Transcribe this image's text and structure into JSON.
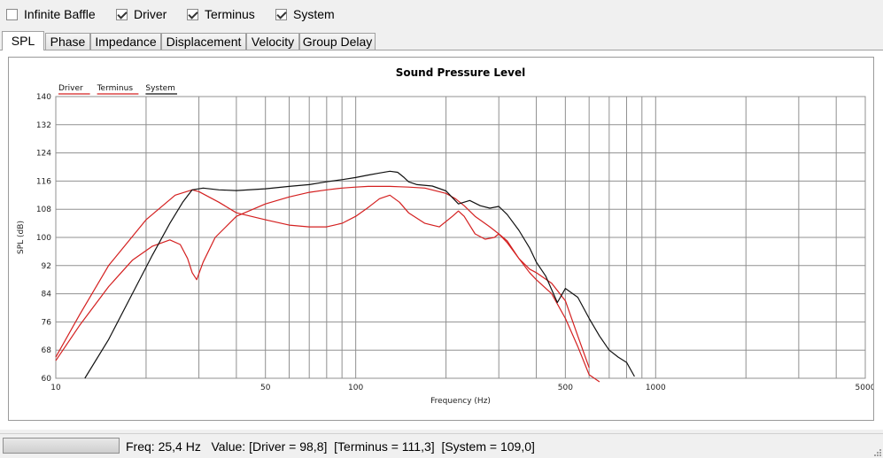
{
  "checkboxes": [
    {
      "label": "Infinite Baffle",
      "checked": false
    },
    {
      "label": "Driver",
      "checked": true
    },
    {
      "label": "Terminus",
      "checked": true
    },
    {
      "label": "System",
      "checked": true
    }
  ],
  "tabs": [
    {
      "label": "SPL",
      "active": true
    },
    {
      "label": "Phase",
      "active": false
    },
    {
      "label": "Impedance",
      "active": false
    },
    {
      "label": "Displacement",
      "active": false
    },
    {
      "label": "Velocity",
      "active": false
    },
    {
      "label": "Group Delay",
      "active": false
    }
  ],
  "status": {
    "freq_text": "Freq: 25,4 Hz",
    "value_prefix": "Value:",
    "driver_text": "[Driver = 98,8]",
    "terminus_text": "[Terminus = 111,3]",
    "system_text": "[System = 109,0]"
  },
  "chart_data": {
    "type": "line",
    "title": "Sound Pressure Level",
    "xlabel": "Frequency (Hz)",
    "ylabel": "SPL (dB)",
    "x_scale": "log",
    "xlim": [
      10,
      5000
    ],
    "ylim": [
      60,
      140
    ],
    "x_ticks": [
      10,
      50,
      100,
      500,
      1000,
      5000
    ],
    "y_ticks": [
      60,
      68,
      76,
      84,
      92,
      100,
      108,
      116,
      124,
      132,
      140
    ],
    "grid": true,
    "legend_position": "top-left",
    "series": [
      {
        "name": "Driver",
        "color": "#d42020",
        "x": [
          10,
          12,
          15,
          18,
          21,
          24,
          26,
          27.5,
          28.5,
          29.5,
          31,
          34,
          40,
          50,
          60,
          70,
          80,
          90,
          100,
          110,
          120,
          130,
          140,
          150,
          170,
          200,
          215,
          230,
          250,
          280,
          300,
          320,
          350,
          380,
          400,
          450,
          500,
          550,
          600
        ],
        "y": [
          65,
          75,
          86,
          93.5,
          97.5,
          99.3,
          98,
          94,
          90,
          88,
          93,
          100,
          106,
          109.5,
          111.5,
          112.8,
          113.5,
          114,
          114.3,
          114.5,
          114.5,
          114.5,
          114.4,
          114.3,
          114,
          112.5,
          111,
          109,
          106,
          103,
          101,
          98.5,
          94,
          91,
          90,
          87,
          82,
          72,
          63
        ]
      },
      {
        "name": "Terminus",
        "color": "#d42020",
        "x": [
          10,
          12,
          15,
          20,
          25,
          28.5,
          30,
          35,
          40,
          50,
          60,
          70,
          80,
          90,
          100,
          110,
          120,
          130,
          140,
          150,
          170,
          190,
          210,
          220,
          230,
          250,
          270,
          290,
          300,
          320,
          350,
          380,
          400,
          450,
          500,
          550,
          600,
          650
        ],
        "y": [
          66,
          78,
          92,
          105,
          112,
          113.5,
          113,
          110,
          107,
          105,
          103.5,
          103,
          103,
          104,
          106,
          108.5,
          111,
          112,
          110,
          107,
          104,
          103,
          106,
          107.5,
          106,
          101,
          99.5,
          100,
          101,
          99,
          94,
          90,
          88,
          84,
          77,
          69,
          61,
          59
        ]
      },
      {
        "name": "System",
        "color": "#111111",
        "x": [
          12.5,
          15,
          18,
          21,
          24,
          26.5,
          28.5,
          31,
          35,
          40,
          50,
          60,
          70,
          80,
          90,
          100,
          110,
          120,
          130,
          138,
          145,
          150,
          160,
          180,
          200,
          220,
          240,
          260,
          280,
          300,
          320,
          350,
          380,
          400,
          430,
          470,
          500,
          550,
          600,
          650,
          700,
          750,
          800,
          850
        ],
        "y": [
          60,
          71,
          84,
          95,
          104,
          110,
          113.5,
          114,
          113.5,
          113.3,
          113.8,
          114.5,
          115,
          115.8,
          116.4,
          117,
          117.7,
          118.3,
          118.8,
          118.5,
          117,
          115.8,
          115,
          114.6,
          113.2,
          109.5,
          110.5,
          109,
          108.3,
          108.8,
          106.5,
          102,
          97,
          93,
          89,
          81.5,
          85.5,
          83,
          77,
          72,
          68,
          66,
          64.5,
          60.5
        ]
      }
    ]
  }
}
